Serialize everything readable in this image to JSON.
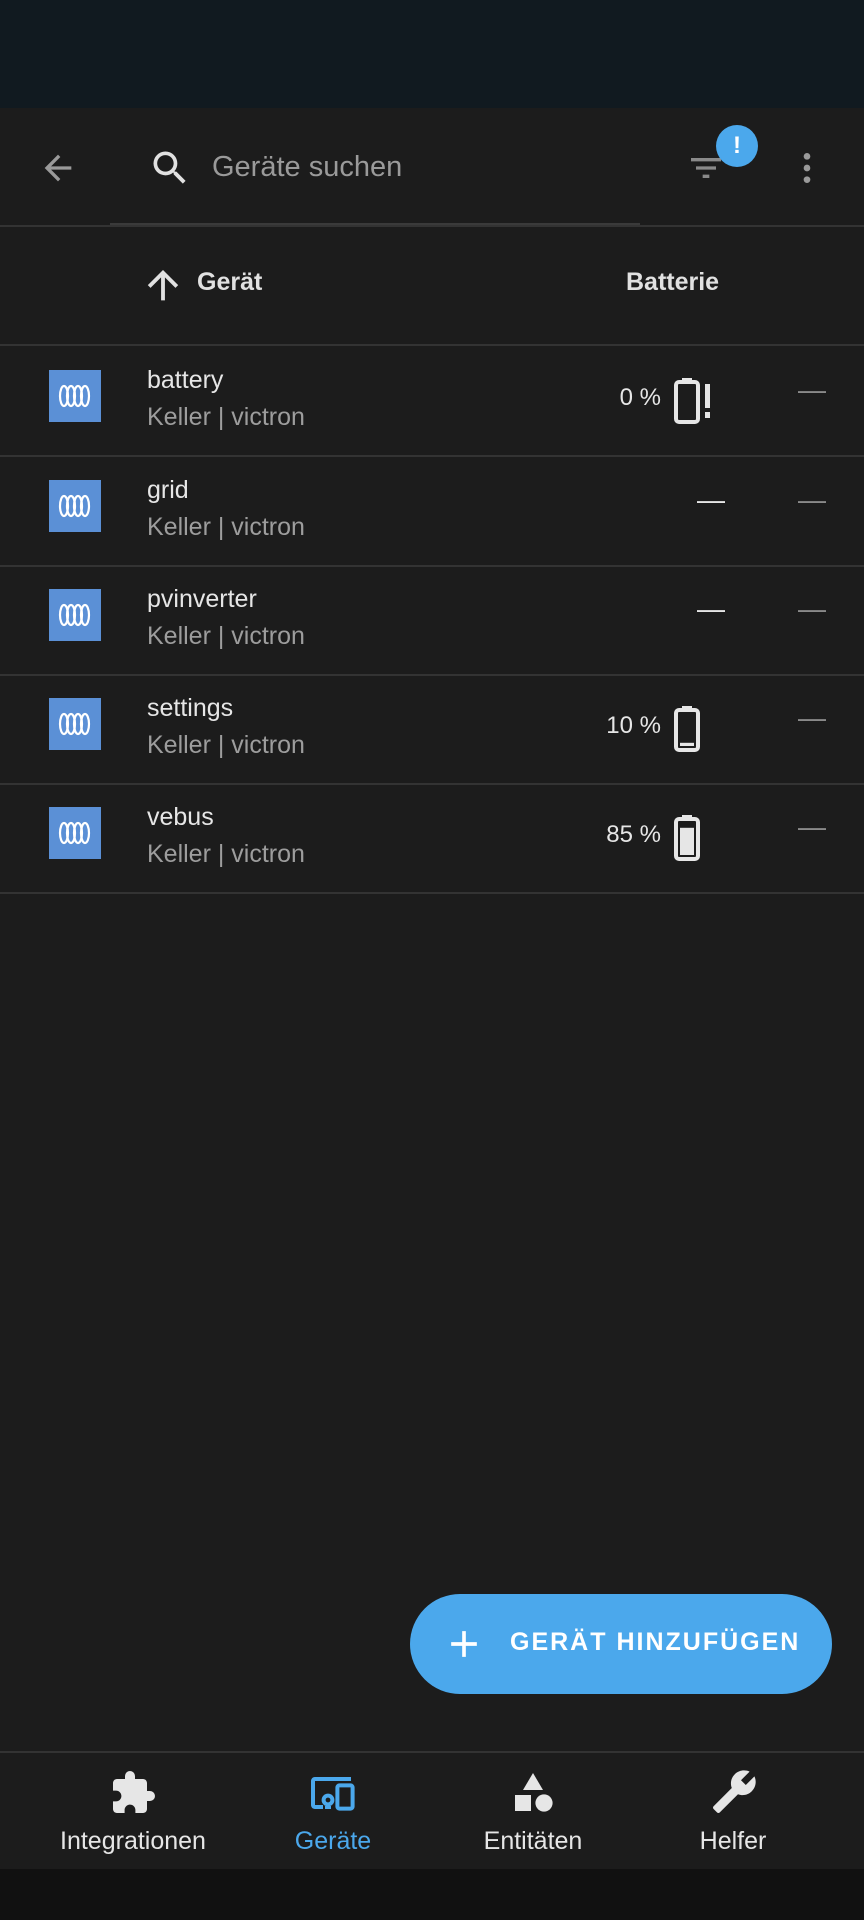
{
  "toolbar": {
    "search_placeholder": "Geräte suchen",
    "filter_badge": "!",
    "accent_color": "#4ba8ec"
  },
  "table": {
    "headers": {
      "device": "Gerät",
      "battery": "Batterie"
    },
    "sort": "ascending",
    "rows": [
      {
        "name": "battery",
        "sub": "Keller | victron",
        "battery_pct": "0 %",
        "battery_icon": "battery-alert-icon",
        "extra": "—"
      },
      {
        "name": "grid",
        "sub": "Keller | victron",
        "battery_dash": "—",
        "extra": "—"
      },
      {
        "name": "pvinverter",
        "sub": "Keller | victron",
        "battery_dash": "—",
        "extra": "—"
      },
      {
        "name": "settings",
        "sub": "Keller | victron",
        "battery_pct": "10 %",
        "battery_icon": "battery-low-icon",
        "battery_level": 0.1,
        "extra": "—"
      },
      {
        "name": "vebus",
        "sub": "Keller | victron",
        "battery_pct": "85 %",
        "battery_icon": "battery-high-icon",
        "battery_level": 0.85,
        "extra": "—"
      }
    ]
  },
  "fab": {
    "label": "GERÄT HINZUFÜGEN"
  },
  "bottom_nav": {
    "items": [
      {
        "label": "Integrationen",
        "icon": "puzzle-icon",
        "active": false
      },
      {
        "label": "Geräte",
        "icon": "devices-icon",
        "active": true
      },
      {
        "label": "Entitäten",
        "icon": "shapes-icon",
        "active": false
      },
      {
        "label": "Helfer",
        "icon": "tools-icon",
        "active": false
      }
    ]
  }
}
